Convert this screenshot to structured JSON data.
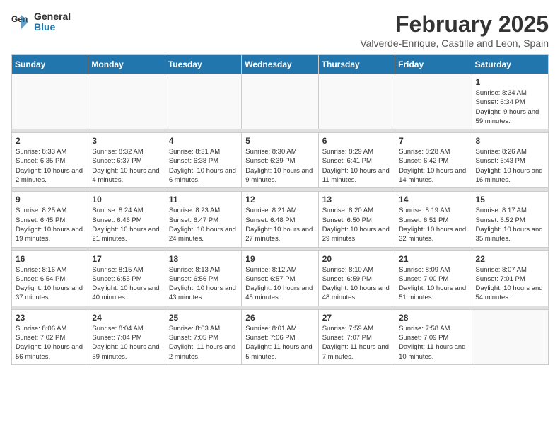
{
  "logo": {
    "text_general": "General",
    "text_blue": "Blue"
  },
  "header": {
    "month_title": "February 2025",
    "subtitle": "Valverde-Enrique, Castille and Leon, Spain"
  },
  "days_of_week": [
    "Sunday",
    "Monday",
    "Tuesday",
    "Wednesday",
    "Thursday",
    "Friday",
    "Saturday"
  ],
  "weeks": [
    [
      {
        "day": "",
        "info": ""
      },
      {
        "day": "",
        "info": ""
      },
      {
        "day": "",
        "info": ""
      },
      {
        "day": "",
        "info": ""
      },
      {
        "day": "",
        "info": ""
      },
      {
        "day": "",
        "info": ""
      },
      {
        "day": "1",
        "info": "Sunrise: 8:34 AM\nSunset: 6:34 PM\nDaylight: 9 hours and 59 minutes."
      }
    ],
    [
      {
        "day": "2",
        "info": "Sunrise: 8:33 AM\nSunset: 6:35 PM\nDaylight: 10 hours and 2 minutes."
      },
      {
        "day": "3",
        "info": "Sunrise: 8:32 AM\nSunset: 6:37 PM\nDaylight: 10 hours and 4 minutes."
      },
      {
        "day": "4",
        "info": "Sunrise: 8:31 AM\nSunset: 6:38 PM\nDaylight: 10 hours and 6 minutes."
      },
      {
        "day": "5",
        "info": "Sunrise: 8:30 AM\nSunset: 6:39 PM\nDaylight: 10 hours and 9 minutes."
      },
      {
        "day": "6",
        "info": "Sunrise: 8:29 AM\nSunset: 6:41 PM\nDaylight: 10 hours and 11 minutes."
      },
      {
        "day": "7",
        "info": "Sunrise: 8:28 AM\nSunset: 6:42 PM\nDaylight: 10 hours and 14 minutes."
      },
      {
        "day": "8",
        "info": "Sunrise: 8:26 AM\nSunset: 6:43 PM\nDaylight: 10 hours and 16 minutes."
      }
    ],
    [
      {
        "day": "9",
        "info": "Sunrise: 8:25 AM\nSunset: 6:45 PM\nDaylight: 10 hours and 19 minutes."
      },
      {
        "day": "10",
        "info": "Sunrise: 8:24 AM\nSunset: 6:46 PM\nDaylight: 10 hours and 21 minutes."
      },
      {
        "day": "11",
        "info": "Sunrise: 8:23 AM\nSunset: 6:47 PM\nDaylight: 10 hours and 24 minutes."
      },
      {
        "day": "12",
        "info": "Sunrise: 8:21 AM\nSunset: 6:48 PM\nDaylight: 10 hours and 27 minutes."
      },
      {
        "day": "13",
        "info": "Sunrise: 8:20 AM\nSunset: 6:50 PM\nDaylight: 10 hours and 29 minutes."
      },
      {
        "day": "14",
        "info": "Sunrise: 8:19 AM\nSunset: 6:51 PM\nDaylight: 10 hours and 32 minutes."
      },
      {
        "day": "15",
        "info": "Sunrise: 8:17 AM\nSunset: 6:52 PM\nDaylight: 10 hours and 35 minutes."
      }
    ],
    [
      {
        "day": "16",
        "info": "Sunrise: 8:16 AM\nSunset: 6:54 PM\nDaylight: 10 hours and 37 minutes."
      },
      {
        "day": "17",
        "info": "Sunrise: 8:15 AM\nSunset: 6:55 PM\nDaylight: 10 hours and 40 minutes."
      },
      {
        "day": "18",
        "info": "Sunrise: 8:13 AM\nSunset: 6:56 PM\nDaylight: 10 hours and 43 minutes."
      },
      {
        "day": "19",
        "info": "Sunrise: 8:12 AM\nSunset: 6:57 PM\nDaylight: 10 hours and 45 minutes."
      },
      {
        "day": "20",
        "info": "Sunrise: 8:10 AM\nSunset: 6:59 PM\nDaylight: 10 hours and 48 minutes."
      },
      {
        "day": "21",
        "info": "Sunrise: 8:09 AM\nSunset: 7:00 PM\nDaylight: 10 hours and 51 minutes."
      },
      {
        "day": "22",
        "info": "Sunrise: 8:07 AM\nSunset: 7:01 PM\nDaylight: 10 hours and 54 minutes."
      }
    ],
    [
      {
        "day": "23",
        "info": "Sunrise: 8:06 AM\nSunset: 7:02 PM\nDaylight: 10 hours and 56 minutes."
      },
      {
        "day": "24",
        "info": "Sunrise: 8:04 AM\nSunset: 7:04 PM\nDaylight: 10 hours and 59 minutes."
      },
      {
        "day": "25",
        "info": "Sunrise: 8:03 AM\nSunset: 7:05 PM\nDaylight: 11 hours and 2 minutes."
      },
      {
        "day": "26",
        "info": "Sunrise: 8:01 AM\nSunset: 7:06 PM\nDaylight: 11 hours and 5 minutes."
      },
      {
        "day": "27",
        "info": "Sunrise: 7:59 AM\nSunset: 7:07 PM\nDaylight: 11 hours and 7 minutes."
      },
      {
        "day": "28",
        "info": "Sunrise: 7:58 AM\nSunset: 7:09 PM\nDaylight: 11 hours and 10 minutes."
      },
      {
        "day": "",
        "info": ""
      }
    ]
  ]
}
